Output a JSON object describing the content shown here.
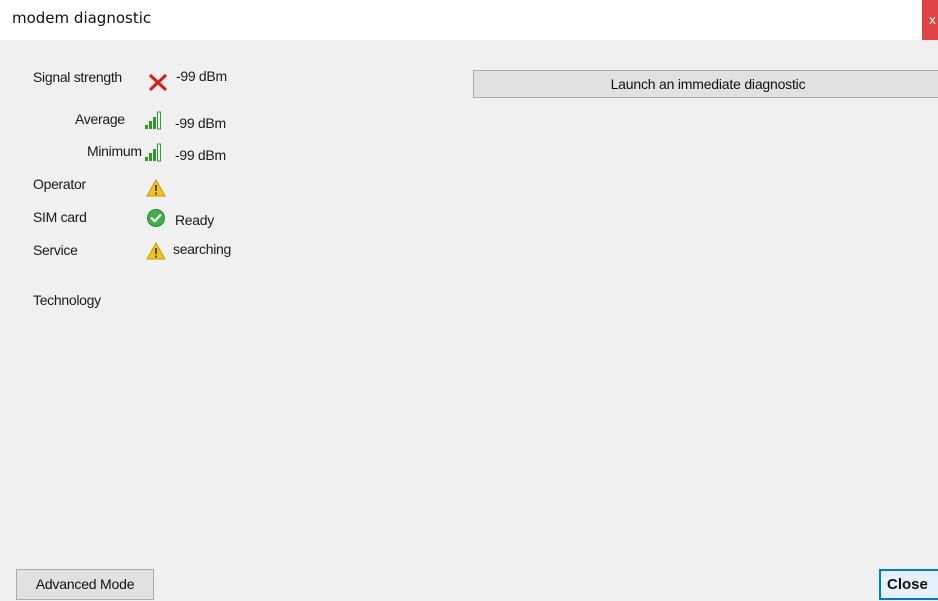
{
  "window": {
    "title": "modem diagnostic",
    "close_glyph": "x"
  },
  "diagnostics": {
    "signal_strength": {
      "label": "Signal strength",
      "icon": "error-x-icon",
      "value": "-99 dBm"
    },
    "average": {
      "label": "Average",
      "icon": "signal-bars-icon",
      "value": "-99 dBm"
    },
    "minimum": {
      "label": "Minimum",
      "icon": "signal-bars-icon",
      "value": "-99 dBm"
    },
    "operator": {
      "label": "Operator",
      "icon": "warning-icon",
      "value": ""
    },
    "sim_card": {
      "label": "SIM card",
      "icon": "check-icon",
      "value": "Ready"
    },
    "service": {
      "label": "Service",
      "icon": "warning-icon",
      "value": "searching"
    },
    "technology": {
      "label": "Technology",
      "value": ""
    }
  },
  "buttons": {
    "launch_diagnostic": "Launch an immediate diagnostic",
    "advanced_mode": "Advanced Mode",
    "close": "Close"
  },
  "colors": {
    "error": "#e01b1b",
    "warning": "#f2c318",
    "ok": "#3fae49",
    "signal": "#2f9a2a",
    "accent": "#0078d7"
  }
}
